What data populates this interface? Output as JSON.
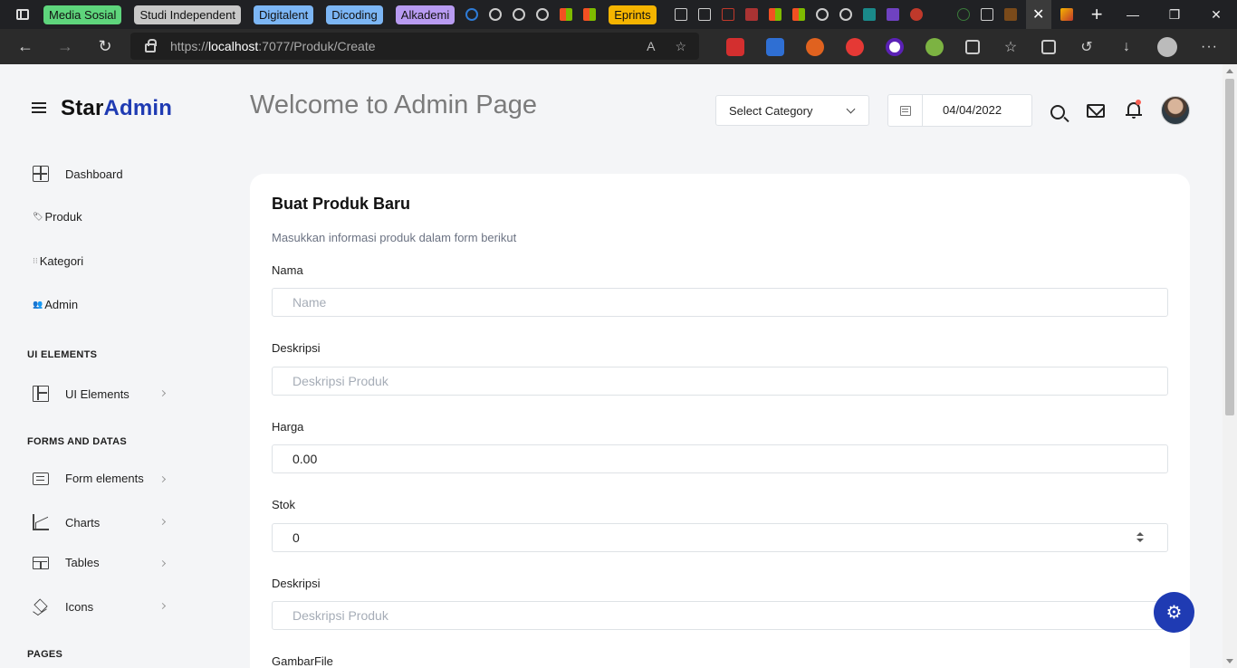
{
  "browser": {
    "tab_groups": [
      {
        "label": "Media Sosial",
        "color": "#5ed57c"
      },
      {
        "label": "Studi Independent",
        "color": "#c8c8c8"
      },
      {
        "label": "Digitalent",
        "color": "#7cb6f5"
      },
      {
        "label": "Dicoding",
        "color": "#7cb6f5"
      },
      {
        "label": "Alkademi",
        "color": "#b89bf2"
      },
      {
        "label": "Eprints",
        "color": "#f5b400"
      }
    ],
    "url_prefix": "https://",
    "url_host": "localhost",
    "url_path": ":7077/Produk/Create"
  },
  "header": {
    "brand_part1": "Star",
    "brand_part2": "Admin",
    "welcome": "Welcome to Admin Page",
    "category_select": "Select Category",
    "date": "04/04/2022"
  },
  "sidebar": {
    "items": [
      {
        "label": "Dashboard"
      },
      {
        "label": "Produk"
      },
      {
        "label": "Kategori"
      },
      {
        "label": "Admin"
      }
    ],
    "section_ui": "UI ELEMENTS",
    "ui_elements": "UI Elements",
    "section_forms": "FORMS AND DATAS",
    "form_elements": "Form elements",
    "charts": "Charts",
    "tables": "Tables",
    "icons": "Icons",
    "section_pages": "PAGES"
  },
  "form": {
    "title": "Buat Produk Baru",
    "description": "Masukkan informasi produk dalam form berikut",
    "nama_label": "Nama",
    "nama_placeholder": "Name",
    "deskripsi_label": "Deskripsi",
    "deskripsi_placeholder": "Deskripsi Produk",
    "harga_label": "Harga",
    "harga_value": "0.00",
    "stok_label": "Stok",
    "stok_value": "0",
    "deskripsi2_label": "Deskripsi",
    "deskripsi2_placeholder": "Deskripsi Produk",
    "gambar_label": "GambarFile"
  }
}
